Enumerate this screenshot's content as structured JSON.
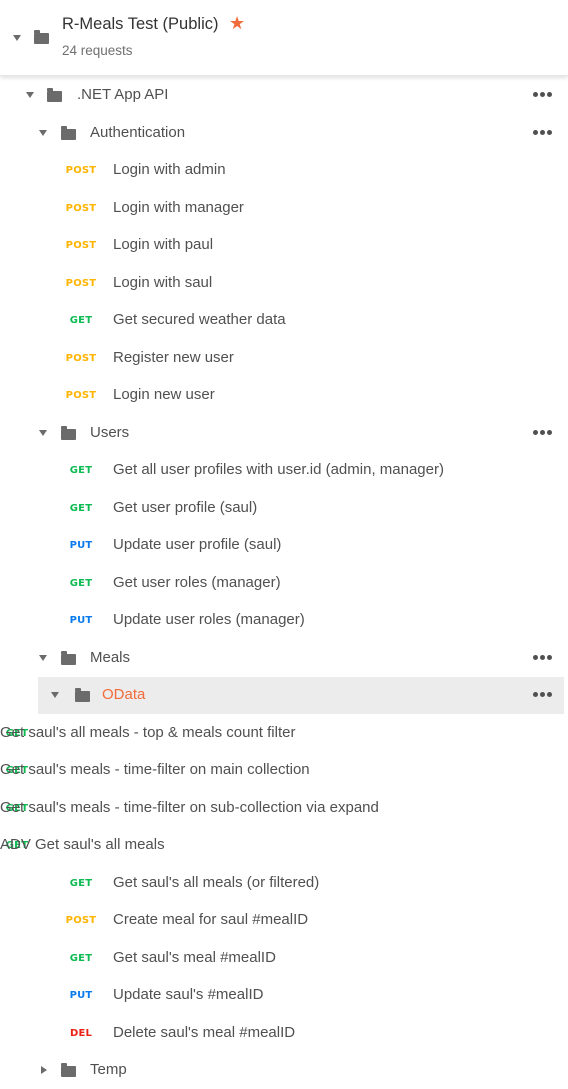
{
  "collection": {
    "title": "R-Meals Test (Public)",
    "subtitle": "24 requests",
    "starred": true
  },
  "tree": [
    {
      "kind": "folder",
      "depth": 0,
      "label": ".NET App API",
      "expanded": true,
      "menu": true
    },
    {
      "kind": "folder",
      "depth": 1,
      "label": "Authentication",
      "expanded": true,
      "menu": true
    },
    {
      "kind": "request",
      "depth": 2,
      "method": "POST",
      "label": "Login with admin"
    },
    {
      "kind": "request",
      "depth": 2,
      "method": "POST",
      "label": "Login with manager"
    },
    {
      "kind": "request",
      "depth": 2,
      "method": "POST",
      "label": "Login with paul"
    },
    {
      "kind": "request",
      "depth": 2,
      "method": "POST",
      "label": "Login with saul"
    },
    {
      "kind": "request",
      "depth": 2,
      "method": "GET",
      "label": "Get secured weather data"
    },
    {
      "kind": "request",
      "depth": 2,
      "method": "POST",
      "label": "Register new user"
    },
    {
      "kind": "request",
      "depth": 2,
      "method": "POST",
      "label": "Login new user"
    },
    {
      "kind": "folder",
      "depth": 1,
      "label": "Users",
      "expanded": true,
      "menu": true
    },
    {
      "kind": "request",
      "depth": 2,
      "method": "GET",
      "label": "Get all user profiles with user.id (admin, manager)"
    },
    {
      "kind": "request",
      "depth": 2,
      "method": "GET",
      "label": "Get user profile (saul)"
    },
    {
      "kind": "request",
      "depth": 2,
      "method": "PUT",
      "label": "Update user profile (saul)"
    },
    {
      "kind": "request",
      "depth": 2,
      "method": "GET",
      "label": "Get user roles (manager)"
    },
    {
      "kind": "request",
      "depth": 2,
      "method": "PUT",
      "label": "Update user roles (manager)"
    },
    {
      "kind": "folder",
      "depth": 1,
      "label": "Meals",
      "expanded": true,
      "menu": true
    },
    {
      "kind": "folder",
      "depth": 2,
      "label": "OData",
      "expanded": true,
      "menu": true,
      "selected": true
    },
    {
      "kind": "request",
      "depth": 3,
      "method": "GET",
      "label": "Get saul's all meals - top & meals count filter"
    },
    {
      "kind": "request",
      "depth": 3,
      "method": "GET",
      "label": "Get saul's meals - time-filter on main collection"
    },
    {
      "kind": "request",
      "depth": 3,
      "method": "GET",
      "label": "Get saul's meals - time-filter on sub-collection via expand"
    },
    {
      "kind": "request",
      "depth": 3,
      "method": "GET",
      "label": "ADV Get saul's all meals"
    },
    {
      "kind": "request",
      "depth": 2,
      "method": "GET",
      "label": "Get saul's all meals (or filtered)"
    },
    {
      "kind": "request",
      "depth": 2,
      "method": "POST",
      "label": "Create meal for saul #mealID"
    },
    {
      "kind": "request",
      "depth": 2,
      "method": "GET",
      "label": "Get saul's meal #mealID"
    },
    {
      "kind": "request",
      "depth": 2,
      "method": "PUT",
      "label": "Update saul's #mealID"
    },
    {
      "kind": "request",
      "depth": 2,
      "method": "DEL",
      "label": "Delete saul's meal #mealID"
    },
    {
      "kind": "folder",
      "depth": 1,
      "label": "Temp",
      "expanded": false,
      "menu": false
    }
  ],
  "colors": {
    "POST": "#ffb400",
    "GET": "#0cbb52",
    "PUT": "#097bed",
    "DEL": "#eb2013",
    "star": "#f26b3a",
    "selected_row": "#ececec"
  }
}
